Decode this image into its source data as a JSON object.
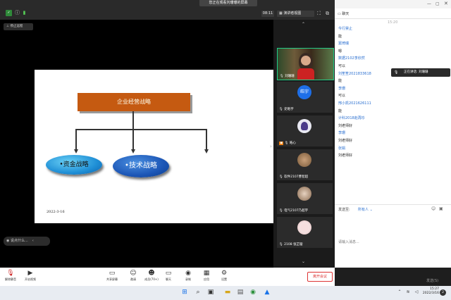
{
  "topbar": {
    "share_banner": "您正在观看刘珊珊的屏幕",
    "timer": "08:11",
    "view_label": "演讲者视图",
    "chat_title": "聊天"
  },
  "share": {
    "stop_label": "停止远程",
    "chat_preview": "说点什么..."
  },
  "slide": {
    "title": "企业经营战略",
    "left_node": "•资金战略",
    "right_node": "•技术战略",
    "date": "2022-3-16"
  },
  "participants": [
    {
      "name": "刘珊珊",
      "avatar_text": "",
      "kind": "video"
    },
    {
      "name": "史皓宇",
      "avatar_text": "皓宇",
      "kind": "initials",
      "color": "#1e6fe8"
    },
    {
      "name": "皓心",
      "avatar_text": "",
      "kind": "avatar"
    },
    {
      "name": "软件2107曹智超",
      "avatar_text": "",
      "kind": "avatar"
    },
    {
      "name": "电气2107乃超宇",
      "avatar_text": "",
      "kind": "avatar"
    },
    {
      "name": "2108 张芷璇",
      "avatar_text": "",
      "kind": "avatar"
    }
  ],
  "chat": {
    "time": "15:20",
    "messages": [
      {
        "type": "name",
        "text": "今行禁止"
      },
      {
        "type": "text",
        "text": "能"
      },
      {
        "type": "name",
        "text": "窦琦瑞"
      },
      {
        "type": "text",
        "text": "嗯"
      },
      {
        "type": "name",
        "text": "数据2102李欣然"
      },
      {
        "type": "text",
        "text": "可以"
      },
      {
        "type": "name",
        "text": "刘笙笙2021833618"
      },
      {
        "type": "text",
        "text": "能"
      },
      {
        "type": "name",
        "text": "李珊"
      },
      {
        "type": "text",
        "text": "可以"
      },
      {
        "type": "name",
        "text": "邢小凯2021626111"
      },
      {
        "type": "text",
        "text": "能"
      },
      {
        "type": "name",
        "text": "计科2018赵再珍"
      },
      {
        "type": "text",
        "text": "刘老师好"
      },
      {
        "type": "name",
        "text": "李珊"
      },
      {
        "type": "text",
        "text": "刘老师好"
      },
      {
        "type": "name",
        "text": "张娟"
      },
      {
        "type": "text",
        "text": "刘老师好"
      }
    ],
    "speaking": "正在讲话: 刘珊珊",
    "send_to": "发送至:",
    "send_target": "所有人",
    "input_placeholder": "请输入消息...",
    "send_label": "发送(S)"
  },
  "toolbar": {
    "mute": "解除静音",
    "video": "开启视频",
    "share": "共享屏幕",
    "invite": "邀请",
    "members": "成员(70+)",
    "chat": "聊天",
    "record": "录制",
    "apps": "应用",
    "settings": "设置",
    "leave": "离开会议"
  },
  "taskbar": {
    "time": "15:27",
    "date": "2022/3/16"
  },
  "colors": {
    "slide_title_fill": "#c55a11",
    "node_fill": "#1f8fd6",
    "accent": "#2a6fd0",
    "leave": "#dd3333"
  }
}
